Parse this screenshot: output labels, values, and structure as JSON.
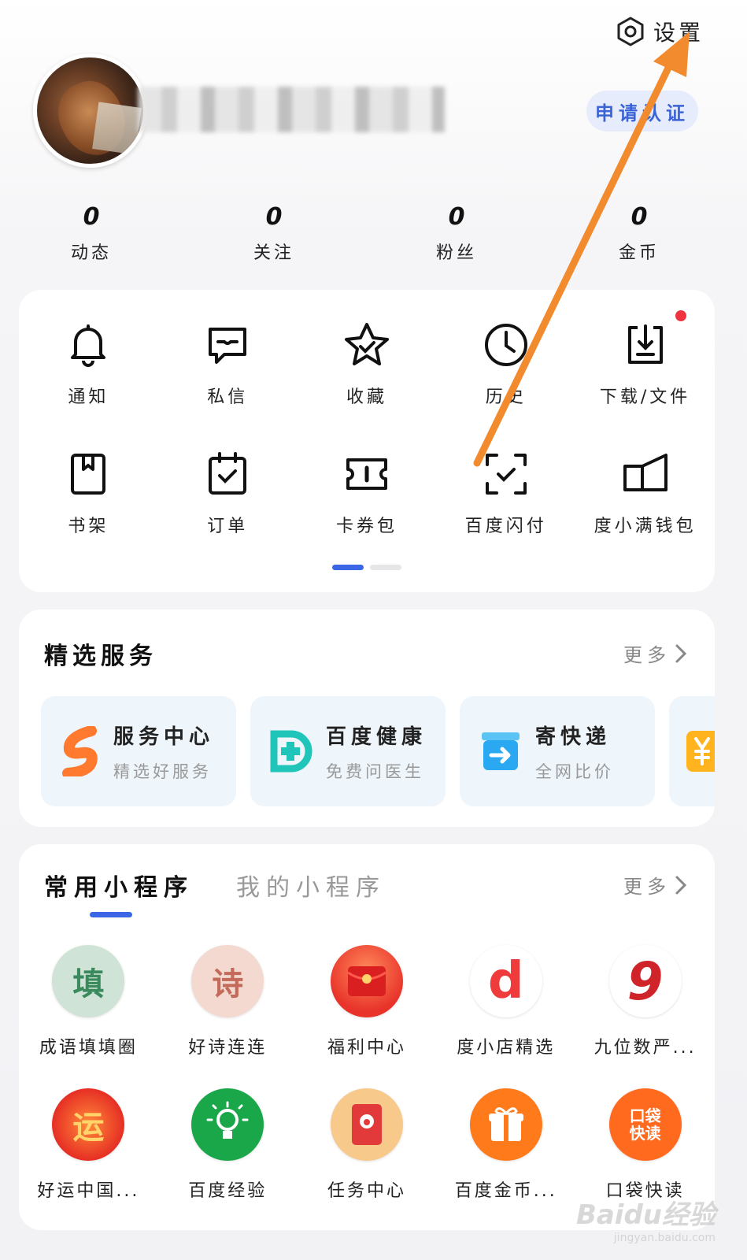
{
  "header": {
    "settings_label": "设置",
    "verify_label": "申请认证"
  },
  "stats": [
    {
      "value": "0",
      "label": "动态"
    },
    {
      "value": "0",
      "label": "关注"
    },
    {
      "value": "0",
      "label": "粉丝"
    },
    {
      "value": "0",
      "label": "金币"
    }
  ],
  "tools": [
    {
      "label": "通知",
      "icon": "bell-icon"
    },
    {
      "label": "私信",
      "icon": "message-icon"
    },
    {
      "label": "收藏",
      "icon": "star-icon"
    },
    {
      "label": "历史",
      "icon": "clock-icon"
    },
    {
      "label": "下载/文件",
      "icon": "download-icon"
    },
    {
      "label": "书架",
      "icon": "bookshelf-icon"
    },
    {
      "label": "订单",
      "icon": "order-icon"
    },
    {
      "label": "卡券包",
      "icon": "ticket-icon"
    },
    {
      "label": "百度闪付",
      "icon": "scan-pay-icon"
    },
    {
      "label": "度小满钱包",
      "icon": "wallet-icon"
    }
  ],
  "services": {
    "title": "精选服务",
    "more": "更多",
    "items": [
      {
        "title": "服务中心",
        "subtitle": "精选好服务",
        "icon": "service-center-icon",
        "color": "#ff7a2f"
      },
      {
        "title": "百度健康",
        "subtitle": "免费问医生",
        "icon": "health-icon",
        "color": "#1fc5b9"
      },
      {
        "title": "寄快递",
        "subtitle": "全网比价",
        "icon": "express-icon",
        "color": "#2aa8f2"
      }
    ]
  },
  "miniprograms": {
    "tab_common": "常用小程序",
    "tab_mine": "我的小程序",
    "more": "更多",
    "items": [
      {
        "label": "成语填填圈",
        "glyph": "填",
        "bg": "#cfe3d6",
        "fg": "#3a8a5e"
      },
      {
        "label": "好诗连连",
        "glyph": "诗",
        "bg": "#f3d9cf",
        "fg": "#c46a5a"
      },
      {
        "label": "福利中心",
        "glyph": "",
        "bg": "#f04a33",
        "fg": "#ffd36b"
      },
      {
        "label": "度小店精选",
        "glyph": "d",
        "bg": "#ffffff",
        "fg": "#ef3b3b"
      },
      {
        "label": "九位数严...",
        "glyph": "9",
        "bg": "#ffffff",
        "fg": "#d0242b"
      },
      {
        "label": "好运中国...",
        "glyph": "运",
        "bg": "#f1402f",
        "fg": "#ffd56a"
      },
      {
        "label": "百度经验",
        "glyph": "",
        "bg": "#1aa74a",
        "fg": "#ffffff"
      },
      {
        "label": "任务中心",
        "glyph": "",
        "bg": "#f7c98b",
        "fg": "#e23a3a"
      },
      {
        "label": "百度金币...",
        "glyph": "",
        "bg": "#ff7a1a",
        "fg": "#ffffff"
      },
      {
        "label": "口袋快读",
        "glyph": "口袋快读",
        "bg": "#ff6a1f",
        "fg": "#ffffff"
      }
    ]
  },
  "colors": {
    "accent": "#3b66e6",
    "annotation_arrow": "#f28a2e",
    "badge": "#ef3340"
  },
  "watermark": {
    "brand": "Baidu经验",
    "url": "jingyan.baidu.com"
  }
}
